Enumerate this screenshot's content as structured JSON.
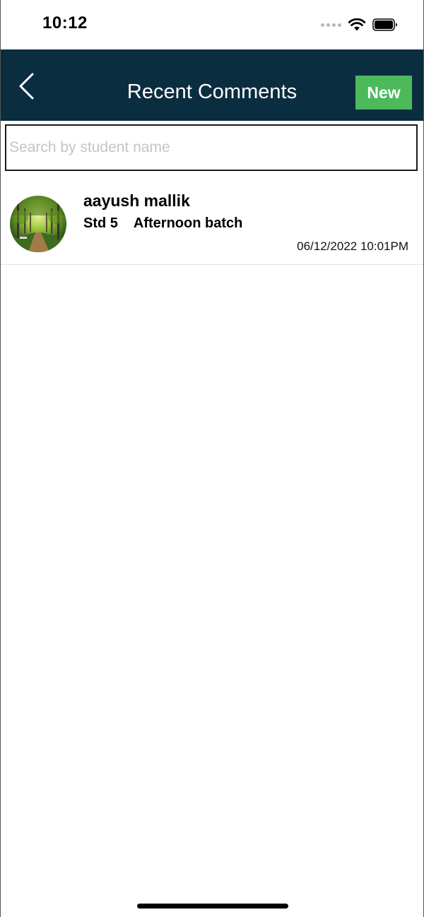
{
  "status_bar": {
    "time": "10:12",
    "icons": [
      "cellular-dots-icon",
      "wifi-icon",
      "battery-icon"
    ]
  },
  "nav": {
    "title": "Recent Comments",
    "back_icon": "chevron-left-icon",
    "new_label": "New"
  },
  "search": {
    "placeholder": "Search by student name",
    "value": ""
  },
  "comments": [
    {
      "name": "aayush mallik",
      "standard": "Std 5",
      "batch": "Afternoon batch",
      "timestamp": "06/12/2022 10:01PM",
      "avatar": "forest-path-photo"
    }
  ],
  "colors": {
    "nav_background": "#0b2d40",
    "new_button": "#4cba5a"
  }
}
